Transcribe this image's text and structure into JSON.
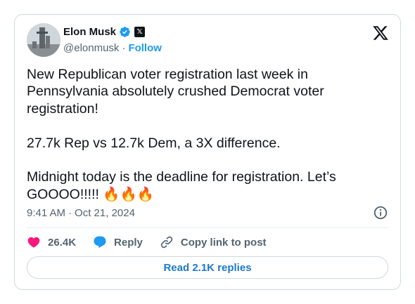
{
  "author": {
    "display_name": "Elon Musk",
    "handle": "@elonmusk",
    "separator": "·",
    "follow_label": "Follow",
    "affiliate_badge": "𝕏"
  },
  "tweet": {
    "text": "New Republican voter registration last week in Pennsylvania absolutely crushed Democrat voter registration!\n\n27.7k Rep vs 12.7k Dem, a 3X difference.\n\nMidnight today is the deadline for registration. Let’s GOOOO!!!!! 🔥🔥🔥",
    "time": "9:41 AM",
    "separator": "·",
    "date": "Oct 21, 2024"
  },
  "actions": {
    "likes": "26.4K",
    "reply_label": "Reply",
    "copy_link_label": "Copy link to post"
  },
  "replies_button": "Read 2.1K replies",
  "colors": {
    "accent": "#1d9bf0",
    "like": "#f91880",
    "text": "#0f1419",
    "muted": "#536471",
    "border": "#cfd9de"
  },
  "icons": {
    "brand": "x-logo-icon",
    "verified": "verified-badge-icon",
    "info": "info-icon",
    "like": "heart-icon",
    "reply": "speech-bubble-icon",
    "copy": "link-icon"
  }
}
